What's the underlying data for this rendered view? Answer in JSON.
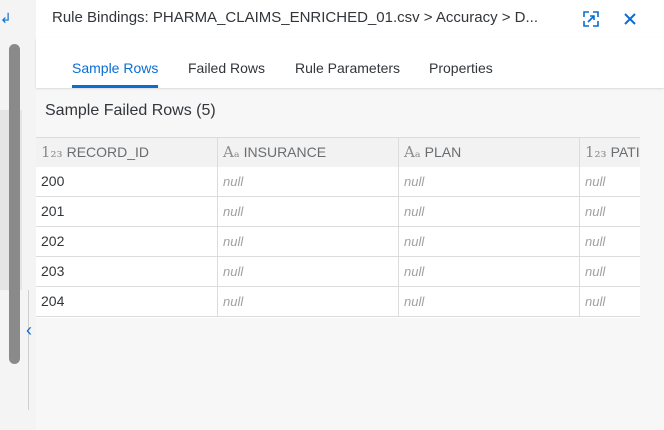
{
  "dialog": {
    "title": "Rule Bindings: PHARMA_CLAIMS_ENRICHED_01.csv > Accuracy > D...",
    "expand_icon": "expand-icon",
    "close_icon": "close-icon"
  },
  "tabs": [
    {
      "label": "Sample Rows",
      "active": true
    },
    {
      "label": "Failed Rows",
      "active": false
    },
    {
      "label": "Rule Parameters",
      "active": false
    },
    {
      "label": "Properties",
      "active": false
    }
  ],
  "section": {
    "title": "Sample Failed Rows (5)"
  },
  "table": {
    "columns": [
      {
        "type_icon": "1₂₃",
        "name": "RECORD_ID"
      },
      {
        "type_icon": "Aₐ",
        "name": "INSURANCE"
      },
      {
        "type_icon": "Aₐ",
        "name": "PLAN"
      },
      {
        "type_icon": "1₂₃",
        "name": "PATIE"
      }
    ],
    "rows": [
      [
        "200",
        "null",
        "null",
        "null"
      ],
      [
        "201",
        "null",
        "null",
        "null"
      ],
      [
        "202",
        "null",
        "null",
        "null"
      ],
      [
        "203",
        "null",
        "null",
        "null"
      ],
      [
        "204",
        "null",
        "null",
        "null"
      ]
    ]
  },
  "colors": {
    "accent": "#0a6ed1",
    "text": "#32363a",
    "null_text": "#a0a0a0"
  }
}
